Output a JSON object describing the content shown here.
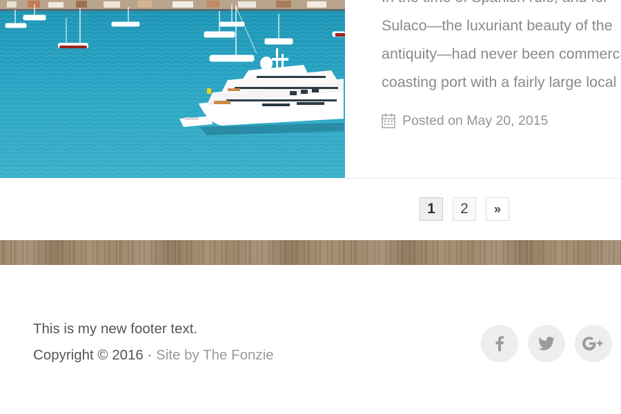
{
  "post": {
    "image_alt": "Harbor with sailboats and a white yacht",
    "excerpt_lines": [
      "In the time of Spanish rule, and for",
      "Sulaco—the luxuriant beauty of the",
      "antiquity—had never been commercially",
      "coasting port with a fairly large local"
    ],
    "date": "Posted on May 20, 2015"
  },
  "pagination": {
    "pages": [
      "1",
      "2"
    ],
    "current": "1",
    "next_label": "»"
  },
  "footer": {
    "text": "This is my new footer text.",
    "copyright": "Copyright © 2016 · ",
    "credit_link": "Site by The Fonzie"
  },
  "social": {
    "icons": [
      "facebook-icon",
      "twitter-icon",
      "google-plus-icon"
    ]
  },
  "colors": {
    "sea": "#2aa5c4",
    "wood": "#9b8567",
    "muted_text": "#8a8a8a"
  }
}
